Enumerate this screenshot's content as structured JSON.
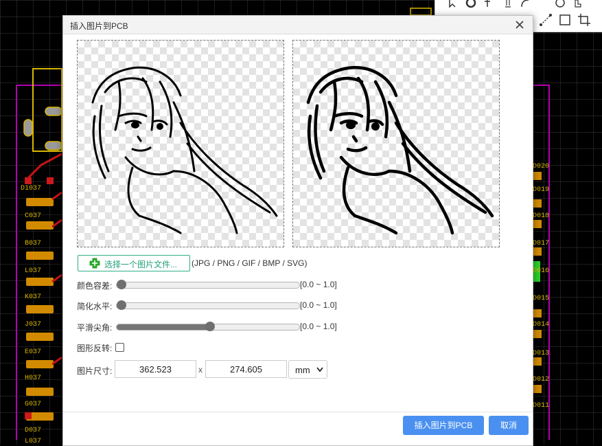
{
  "pcb_background": {
    "board_labels": [
      "D1037",
      "C037",
      "B037",
      "L037",
      "K037",
      "J037",
      "E037",
      "H037",
      "G037",
      "D037",
      "L037",
      "D020",
      "D019",
      "D018",
      "D017",
      "D016",
      "D015",
      "D014",
      "D013",
      "D012",
      "D011"
    ]
  },
  "toolbar": {
    "icons": [
      "select-icon",
      "ellipse-icon",
      "pin-icon",
      "arc-icon",
      "arc2-icon",
      "circle-icon",
      "pan-icon",
      "line-icon",
      "rect-icon",
      "crop-icon"
    ]
  },
  "dialog": {
    "title": "插入图片到PCB",
    "close_glyph": "✕",
    "choose_file_label": "选择一个图片文件...",
    "formats_text": "(JPG / PNG / GIF / BMP / SVG)",
    "color_tolerance": {
      "label": "颜色容差:",
      "value": 0.0,
      "range": "[0.0 ~ 1.0]"
    },
    "simplify_level": {
      "label": "简化水平:",
      "value": 0.0,
      "range": "[0.0 ~ 1.0]"
    },
    "smooth_corners": {
      "label": "平滑尖角:",
      "value": 0.5,
      "range": "[0.0 ~ 1.0]"
    },
    "invert": {
      "label": "图形反转:",
      "checked": false
    },
    "size": {
      "label": "图片尺寸:",
      "width": "362.523",
      "separator": "x",
      "height": "274.605",
      "unit": "mm"
    },
    "insert_button": "插入图片到PCB",
    "cancel_button": "取消"
  },
  "colors": {
    "primary_button": "#4a90f0",
    "accent_green": "#21a07a",
    "plus_green": "#2bb02b"
  }
}
